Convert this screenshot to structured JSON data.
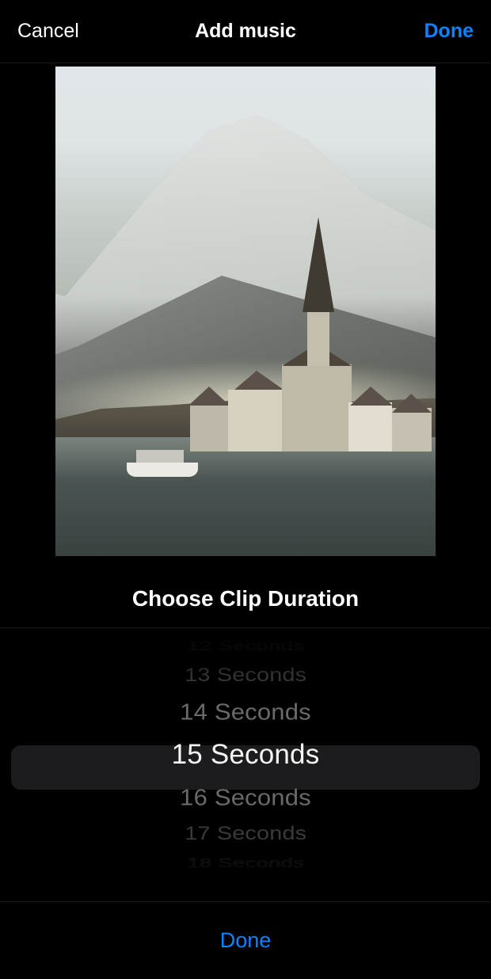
{
  "accent_color": "#0a84ff",
  "nav": {
    "cancel_label": "Cancel",
    "title": "Add music",
    "done_label": "Done"
  },
  "section": {
    "title": "Choose Clip Duration"
  },
  "picker": {
    "selected_index": 3,
    "options": [
      "12 Seconds",
      "13 Seconds",
      "14 Seconds",
      "15 Seconds",
      "16 Seconds",
      "17 Seconds",
      "18 Seconds"
    ]
  },
  "bottom": {
    "done_label": "Done"
  }
}
